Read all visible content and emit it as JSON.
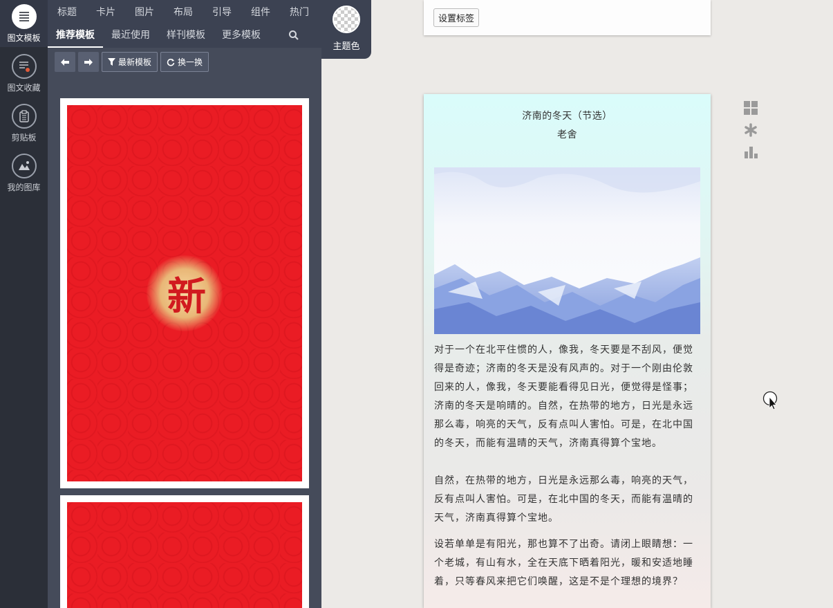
{
  "rail": {
    "items": [
      {
        "label": "图文模板"
      },
      {
        "label": "图文收藏"
      },
      {
        "label": "剪贴板"
      },
      {
        "label": "我的图库"
      }
    ]
  },
  "top_tabs": [
    "标题",
    "卡片",
    "图片",
    "布局",
    "引导",
    "组件",
    "热门"
  ],
  "sub_tabs": [
    "推荐模板",
    "最近使用",
    "样刊模板",
    "更多模板"
  ],
  "theme": {
    "label": "主题色"
  },
  "toolbar": {
    "newest_label": "最新模板",
    "shuffle_label": "换一换"
  },
  "template_card": {
    "seal_text": "新"
  },
  "editor": {
    "tag_button": "设置标签",
    "title": "济南的冬天（节选）",
    "author": "老舍",
    "paragraph1": "对于一个在北平住惯的人，像我，冬天要是不刮风，便觉得是奇迹；济南的冬天是没有风声的。对于一个刚由伦敦回来的人，像我，冬天要能看得见日光，便觉得是怪事；济南的冬天是响晴的。自然，在热带的地方，日光是永远那么毒，响亮的天气，反有点叫人害怕。可是，在北中国的冬天，而能有温晴的天气，济南真得算个宝地。",
    "paragraph2": "自然，在热带的地方，日光是永远那么毒，响亮的天气，反有点叫人害怕。可是，在北中国的冬天，而能有温晴的天气，济南真得算个宝地。",
    "paragraph3": "设若单单是有阳光，那也算不了出奇。请闭上眼睛想：一个老城，有山有水，全在天底下晒着阳光，暖和安适地睡着，只等春风来把它们唤醒，这是不是个理想的境界？"
  },
  "colors": {
    "accent_red": "#ea1c24",
    "panel": "#454b5a",
    "rail": "#2b2f38"
  }
}
